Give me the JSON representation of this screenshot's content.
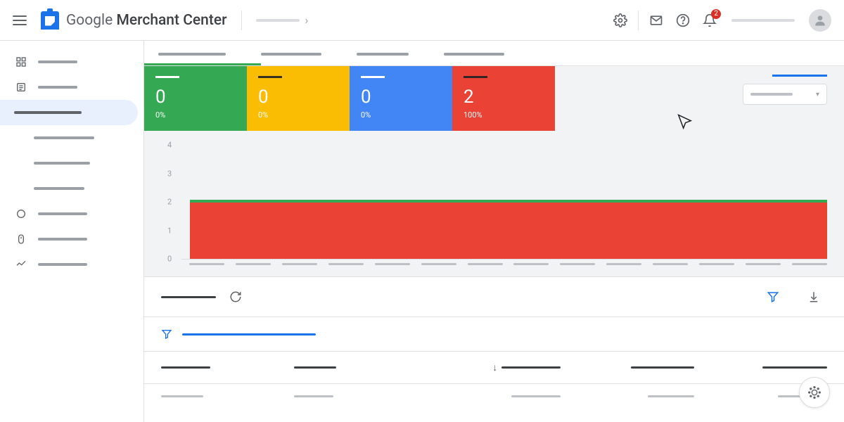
{
  "header": {
    "product_name_plain": "Google",
    "product_name_bold": " Merchant Center",
    "notification_count": "2"
  },
  "sidebar": {
    "items": [
      {
        "icon": "dashboard-icon",
        "w": 56
      },
      {
        "icon": "list-icon",
        "w": 56
      },
      {
        "icon": null,
        "w": 96,
        "active": true
      },
      {
        "icon": null,
        "w": 86,
        "sub": true
      },
      {
        "icon": null,
        "w": 80,
        "sub": true
      },
      {
        "icon": null,
        "w": 72,
        "sub": true
      },
      {
        "icon": "circle-icon",
        "w": 70
      },
      {
        "icon": "mouse-icon",
        "w": 70
      },
      {
        "icon": "trend-icon",
        "w": 70
      }
    ]
  },
  "tabs": [
    {
      "w": 96,
      "active": true
    },
    {
      "w": 86
    },
    {
      "w": 74
    },
    {
      "w": 86
    }
  ],
  "cards": [
    {
      "color": "green",
      "value": "0",
      "pct": "0%"
    },
    {
      "color": "yellow",
      "value": "0",
      "pct": "0%"
    },
    {
      "color": "blue",
      "value": "0",
      "pct": "0%"
    },
    {
      "color": "red",
      "value": "2",
      "pct": "100%"
    }
  ],
  "chart_data": {
    "type": "bar",
    "ylim": [
      0,
      4
    ],
    "yticks": [
      0,
      1,
      2,
      3,
      4
    ],
    "series": [
      {
        "name": "red-series",
        "value_constant": 2,
        "color": "#ea4335"
      },
      {
        "name": "green-series",
        "value_constant": 2,
        "color": "#34a853"
      }
    ],
    "x_tick_count": 14
  },
  "table": {
    "columns": [
      {
        "w": 70
      },
      {
        "w": 60
      },
      {
        "w": 84,
        "sorted": "asc"
      },
      {
        "w": 90
      },
      {
        "w": 92
      }
    ],
    "row": [
      60,
      56,
      70,
      66,
      70
    ]
  },
  "colors": {
    "blue": "#1a73e8",
    "green": "#34a853",
    "yellow": "#fbbc04",
    "gblue": "#4285f4",
    "red": "#ea4335"
  }
}
